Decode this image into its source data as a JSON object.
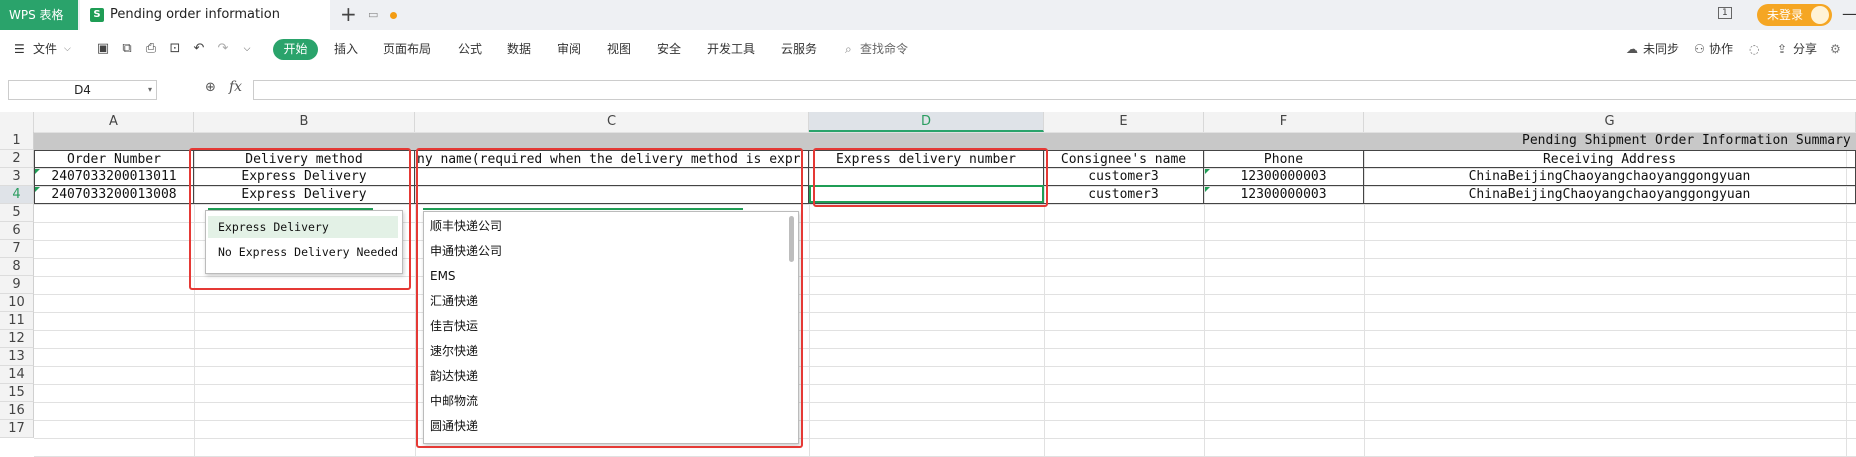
{
  "app": {
    "name": "WPS 表格",
    "doc_tab_title": "Pending order information",
    "window_count": "1",
    "login_label": "未登录"
  },
  "menu": {
    "file": "文件",
    "start": "开始",
    "items": [
      "插入",
      "页面布局",
      "公式",
      "数据",
      "审阅",
      "视图",
      "安全",
      "开发工具",
      "云服务"
    ],
    "search_placeholder": "查找命令",
    "sync": "未同步",
    "collab": "协作",
    "share": "分享"
  },
  "formula_bar": {
    "name_box": "D4",
    "fx": "fx",
    "value": ""
  },
  "columns": [
    "A",
    "B",
    "C",
    "D",
    "E",
    "F",
    "G"
  ],
  "active_column": "D",
  "rows": [
    "1",
    "2",
    "3",
    "4",
    "5",
    "6",
    "7",
    "8",
    "9",
    "10",
    "11",
    "12",
    "13",
    "14",
    "15",
    "16",
    "17"
  ],
  "active_row": "4",
  "sheet": {
    "title": "Pending Shipment Order Information Summary",
    "headers": [
      "Order Number",
      "Delivery method",
      "ny name(required when the delivery method is expr",
      "Express delivery number",
      "Consignee's name",
      "Phone",
      "Receiving Address"
    ],
    "data": [
      [
        "2407033200013011",
        "Express Delivery",
        "",
        "",
        "customer3",
        "12300000003",
        "ChinaBeijingChaoyangchaoyanggongyuan"
      ],
      [
        "2407033200013008",
        "Express Delivery",
        "",
        "",
        "customer3",
        "12300000003",
        "ChinaBeijingChaoyangchaoyanggongyuan"
      ]
    ]
  },
  "delivery_dropdown": [
    "Express Delivery",
    "No Express Delivery Needed"
  ],
  "company_dropdown": [
    "顺丰快递公司",
    "申通快递公司",
    "EMS",
    "汇通快递",
    "佳吉快运",
    "速尔快递",
    "韵达快递",
    "中邮物流",
    "圆通快递"
  ],
  "colors": {
    "brand_green": "#2aa36b",
    "annotation_red": "#e53935",
    "login_orange": "#f5a623"
  }
}
